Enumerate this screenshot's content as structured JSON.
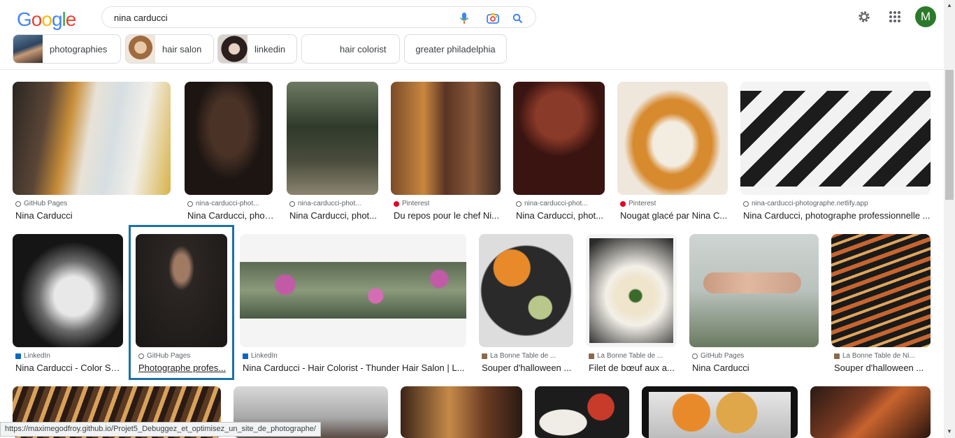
{
  "header": {
    "logo_letters": [
      "G",
      "o",
      "o",
      "g",
      "l",
      "e"
    ],
    "search_value": "nina carducci",
    "avatar_initial": "M"
  },
  "chips": [
    {
      "label": "photographies"
    },
    {
      "label": "hair salon"
    },
    {
      "label": "linkedin"
    },
    {
      "label": "hair colorist"
    },
    {
      "label": "greater philadelphia"
    }
  ],
  "results": [
    {
      "source": "GitHub Pages",
      "title": "Nina Carducci",
      "favicon": "globe"
    },
    {
      "source": "nina-carducci-phot...",
      "title": "Nina Carducci, phot...",
      "favicon": "globe"
    },
    {
      "source": "nina-carducci-phot...",
      "title": "Nina Carducci, phot...",
      "favicon": "globe"
    },
    {
      "source": "Pinterest",
      "title": "Du repos pour le chef Ni...",
      "favicon": "pinterest"
    },
    {
      "source": "nina-carducci-phot...",
      "title": "Nina Carducci, phot...",
      "favicon": "globe"
    },
    {
      "source": "Pinterest",
      "title": "Nougat glacé par Nina C...",
      "favicon": "pinterest"
    },
    {
      "source": "nina-carducci-photographe.netlify.app",
      "title": "Nina Carducci, photographe professionnelle ...",
      "favicon": "globe"
    },
    {
      "source": "LinkedIn",
      "title": "Nina Carducci - Color Sp...",
      "favicon": "linkedin"
    },
    {
      "source": "GitHub Pages",
      "title": "Photographe profes...",
      "favicon": "globe"
    },
    {
      "source": "LinkedIn",
      "title": "Nina Carducci - Hair Colorist - Thunder Hair Salon | L...",
      "favicon": "linkedin"
    },
    {
      "source": "La Bonne Table de ...",
      "title": "Souper d'halloween ...",
      "favicon": "site"
    },
    {
      "source": "La Bonne Table de ...",
      "title": "Filet de bœuf aux a...",
      "favicon": "site"
    },
    {
      "source": "GitHub Pages",
      "title": "Nina Carducci",
      "favicon": "globe"
    },
    {
      "source": "La Bonne Table de Ni...",
      "title": "Souper d'halloween ...",
      "favicon": "site"
    }
  ],
  "status_url": "https://maximegodfroy.github.io/Projet5_Debuggez_et_optimisez_un_site_de_photographe/",
  "colors": {
    "google_blue": "#4285f4",
    "google_red": "#ea4335",
    "google_yellow": "#fbbc05",
    "google_green": "#34a853",
    "selection": "#1a73a8",
    "avatar": "#2b7a2b"
  }
}
